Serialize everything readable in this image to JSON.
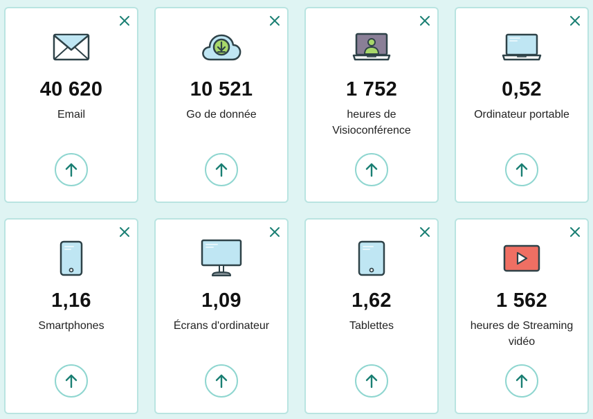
{
  "colors": {
    "background": "#dff4f3",
    "card_border": "#b9e4e1",
    "accent": "#1a7f73",
    "button_border": "#8fd6d0"
  },
  "cards": [
    {
      "value": "40 620",
      "label": "Email",
      "icon": "envelope-icon"
    },
    {
      "value": "10 521",
      "label": "Go de donnée",
      "icon": "cloud-download-icon"
    },
    {
      "value": "1 752",
      "label": "heures de Visioconférence",
      "icon": "video-conference-icon"
    },
    {
      "value": "0,52",
      "label": "Ordinateur portable",
      "icon": "laptop-icon"
    },
    {
      "value": "1,16",
      "label": "Smartphones",
      "icon": "smartphone-icon"
    },
    {
      "value": "1,09",
      "label": "Écrans d'ordinateur",
      "icon": "monitor-icon"
    },
    {
      "value": "1,62",
      "label": "Tablettes",
      "icon": "tablet-icon"
    },
    {
      "value": "1 562",
      "label": "heures de Streaming vidéo",
      "icon": "video-play-icon"
    }
  ]
}
